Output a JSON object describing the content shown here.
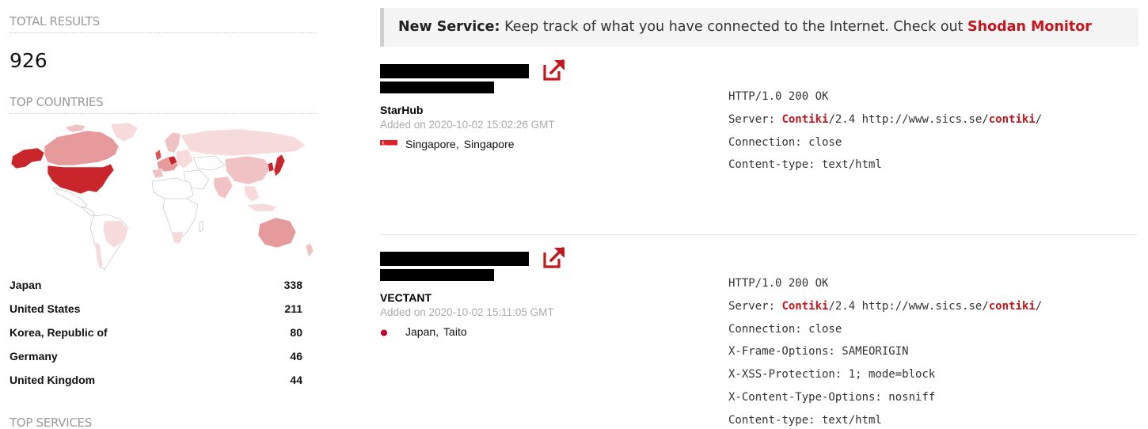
{
  "sidebar": {
    "total_results_title": "TOTAL RESULTS",
    "total_results_count": "926",
    "top_countries_title": "TOP COUNTRIES",
    "countries": [
      {
        "name": "Japan",
        "count": "338"
      },
      {
        "name": "United States",
        "count": "211"
      },
      {
        "name": "Korea, Republic of",
        "count": "80"
      },
      {
        "name": "Germany",
        "count": "46"
      },
      {
        "name": "United Kingdom",
        "count": "44"
      }
    ],
    "top_services_title": "TOP SERVICES"
  },
  "notice": {
    "label": "New Service:",
    "text": " Keep track of what you have connected to the Internet. Check out ",
    "link": "Shodan Monitor"
  },
  "results": [
    {
      "org": "StarHub",
      "added": "Added on 2020-10-02 15:02:26 GMT",
      "country": "Singapore,",
      "city": "Singapore",
      "flag_icon": "singapore-flag-icon",
      "banner": {
        "status": "HTTP/1.0 200 OK",
        "server_prefix": "Server: ",
        "server_hl": "Contiki",
        "server_mid": "/2.4 http://www.sics.se/",
        "server_hl2": "contiki",
        "server_end": "/",
        "lines": [
          "Connection: close",
          "Content-type: text/html"
        ]
      }
    },
    {
      "org": "VECTANT",
      "added": "Added on 2020-10-02 15:11:05 GMT",
      "country": "Japan,",
      "city": "Taito",
      "flag_icon": "japan-flag-icon",
      "banner": {
        "status": "HTTP/1.0 200 OK",
        "server_prefix": "Server: ",
        "server_hl": "Contiki",
        "server_mid": "/2.4 http://www.sics.se/",
        "server_hl2": "contiki",
        "server_end": "/",
        "lines": [
          "Connection: close",
          "X-Frame-Options: SAMEORIGIN",
          "X-XSS-Protection: 1; mode=block",
          "X-Content-Type-Options: nosniff",
          "Content-type: text/html"
        ]
      }
    }
  ],
  "colors": {
    "accent": "#c4161c",
    "muted": "#999999"
  }
}
